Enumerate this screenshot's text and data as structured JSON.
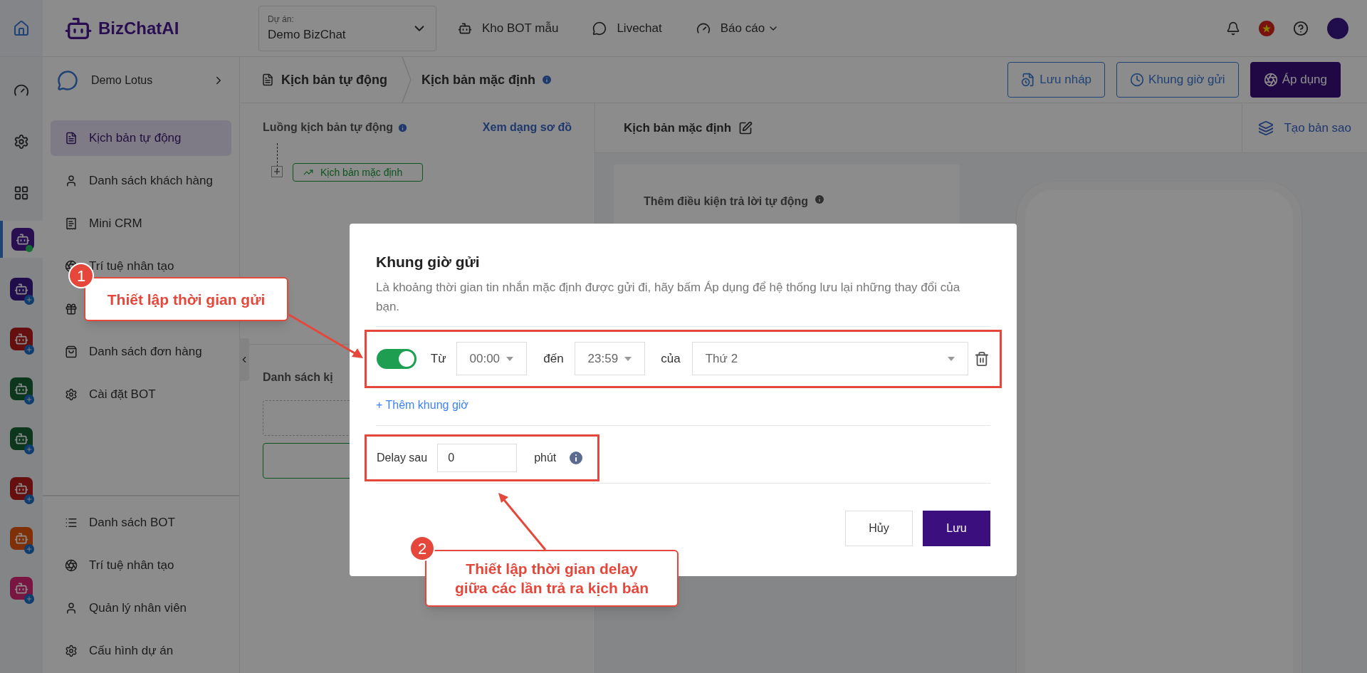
{
  "top_bar": {
    "logo": "BizChatAI",
    "project": {
      "label": "Dự án:",
      "value": "Demo BizChat"
    },
    "nav": [
      "Kho BOT mẫu",
      "Livechat",
      "Báo cáo"
    ]
  },
  "rail": {
    "apps": [
      {
        "selected": true
      },
      {
        "selected": false
      },
      {
        "selected": false
      },
      {
        "selected": false
      },
      {
        "selected": false
      },
      {
        "selected": false
      },
      {
        "selected": false
      },
      {
        "selected": false
      }
    ]
  },
  "sidebar": {
    "bot_name": "Demo Lotus",
    "items": [
      {
        "label": "Kịch bản tự động",
        "selected": true
      },
      {
        "label": "Danh sách khách hàng",
        "selected": false
      },
      {
        "label": "Mini CRM",
        "selected": false
      },
      {
        "label": "Trí tuệ nhân tạo",
        "selected": false
      },
      {
        "selected": false
      },
      {
        "label": "Danh sách đơn hàng",
        "selected": false
      },
      {
        "label": "Cài đặt BOT",
        "selected": false
      }
    ],
    "bottom_items": [
      "Danh sách BOT",
      "Trí tuệ nhân tạo",
      "Quản lý nhân viên",
      "Cấu hình dự án"
    ]
  },
  "breadcrumb": [
    "Kịch bản tự động",
    "Kịch bản mặc định"
  ],
  "actions": [
    "Lưu nháp",
    "Khung giờ gửi",
    "Áp dụng"
  ],
  "flow_panel": {
    "title": "Luồng kịch bản tự động",
    "link": "Xem dạng sơ đồ",
    "node": "Kịch bản mặc định",
    "list_title": "Danh sách kị"
  },
  "editor": {
    "title": "Kịch bản mặc định",
    "copy_button": "Tạo bản sao",
    "card_title": "Thêm điều kiện trả lời tự động"
  },
  "modal": {
    "title": "Khung giờ gửi",
    "description": "Là khoảng thời gian tin nhắn mặc định được gửi đi, hãy bấm Áp dụng để hệ thống lưu lại những thay đổi của bạn.",
    "schedules": [
      {
        "on": true,
        "from_label": "Từ",
        "from": "00:00",
        "to_label": "đến",
        "to": "23:59",
        "of_label": "của",
        "day": "Thứ 2"
      }
    ],
    "add_link": "+ Thêm khung giờ",
    "delay": {
      "label": "Delay sau",
      "value": "0",
      "unit": "phút"
    },
    "cancel": "Hủy",
    "save": "Lưu"
  },
  "annotations": [
    {
      "number": "1",
      "text": "Thiết lập thời gian gửi"
    },
    {
      "number": "2",
      "text": "Thiết lập thời gian delay giữa các lần trả ra kịch bản"
    }
  ]
}
